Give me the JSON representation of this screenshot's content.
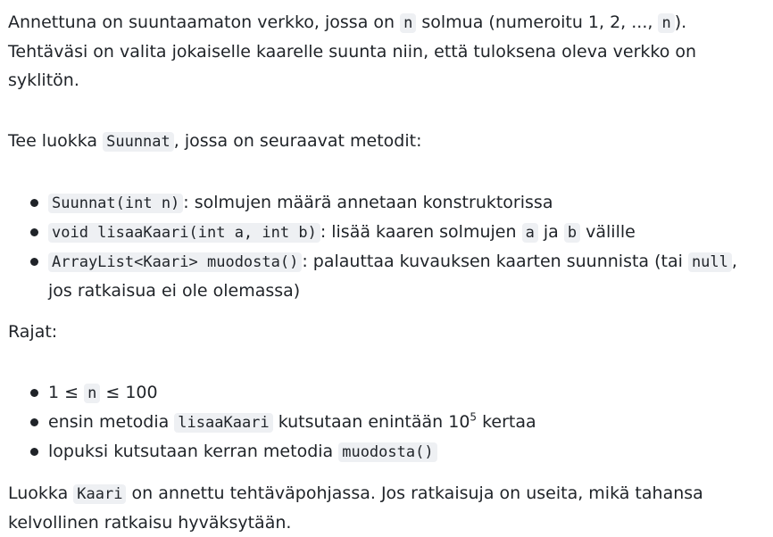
{
  "intro": {
    "text1": "Annettuna on suuntaamaton verkko, jossa on ",
    "code1": "n",
    "text2": " solmua (numeroitu 1, 2, ..., ",
    "code2": "n",
    "text3": "). Tehtäväsi on valita jokaiselle kaarelle suunta niin, että tuloksena oleva verkko on syklitön."
  },
  "class_para": {
    "text1": "Tee luokka ",
    "code1": "Suunnat",
    "text2": ", jossa on seuraavat metodit:"
  },
  "methods": [
    {
      "code": "Suunnat(int n)",
      "text": ": solmujen määrä annetaan konstruktorissa"
    },
    {
      "code": "void lisaaKaari(int a, int b)",
      "text1": ": lisää kaaren solmujen ",
      "code_a": "a",
      "text2": " ja ",
      "code_b": "b",
      "text3": " välille"
    },
    {
      "code": "ArrayList<Kaari> muodosta()",
      "text1": ": palauttaa kuvauksen kaarten suunnista (tai ",
      "code_null": "null",
      "text2": ", jos ratkaisua ei ole olemassa)"
    }
  ],
  "limits": {
    "heading": "Rajat:",
    "items": [
      {
        "text1": "1 ≤ ",
        "code": "n",
        "text2": " ≤ 100"
      },
      {
        "text1": "ensin metodia ",
        "code": "lisaaKaari",
        "text2": " kutsutaan enintään 10",
        "sup": "5",
        "text3": " kertaa"
      },
      {
        "text1": "lopuksi kutsutaan kerran metodia ",
        "code": "muodosta()"
      }
    ]
  },
  "closing": {
    "text1": "Luokka ",
    "code1": "Kaari",
    "text2": " on annettu tehtäväpohjassa. Jos ratkaisuja on useita, mikä tahansa kelvollinen ratkaisu hyväksytään."
  }
}
